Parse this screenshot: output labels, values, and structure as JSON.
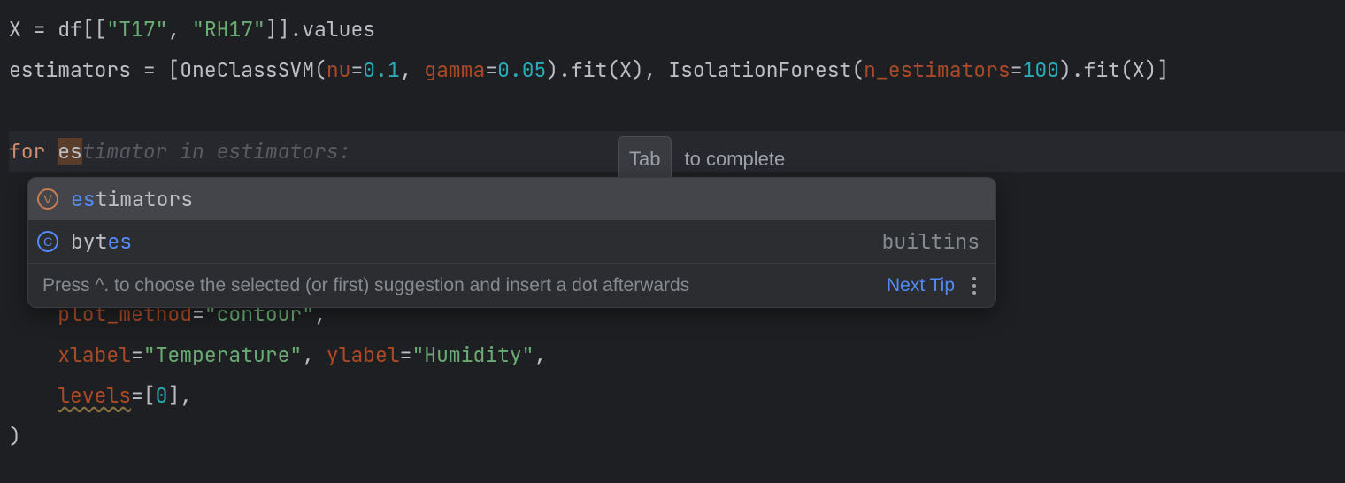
{
  "code": {
    "line1": {
      "a": "X ",
      "eq": "= ",
      "b": "df[[",
      "s1": "\"T17\"",
      "c": ", ",
      "s2": "\"RH17\"",
      "d": "]].values"
    },
    "line2": {
      "a": "estimators ",
      "eq": "= ",
      "b": "[OneClassSVM(",
      "p1": "nu",
      "eq1": "=",
      "n1": "0.1",
      "c1": ", ",
      "p2": "gamma",
      "eq2": "=",
      "n2": "0.05",
      "d": ").fit(X), IsolationForest(",
      "p3": "n_estimators",
      "eq3": "=",
      "n3": "100",
      "e": ").fit(X)]"
    },
    "line3": {
      "kw": "for ",
      "typed": "es",
      "ghost": "timator in estimators:"
    },
    "line5": {
      "pad": "    ",
      "p": "plot_method",
      "eq": "=",
      "s": "\"contour\"",
      "c": ","
    },
    "line6": {
      "pad": "    ",
      "p1": "xlabel",
      "eq1": "=",
      "s1": "\"Temperature\"",
      "c1": ", ",
      "p2": "ylabel",
      "eq2": "=",
      "s2": "\"Humidity\"",
      "c2": ","
    },
    "line7": {
      "pad": "    ",
      "p": "levels",
      "eq": "=[",
      "n": "0",
      "c": "],"
    },
    "line8": {
      "a": ")"
    }
  },
  "hint": {
    "key": "Tab",
    "text": "to complete"
  },
  "popup": {
    "items": [
      {
        "kind": "V",
        "match": "es",
        "rest": "timators",
        "tail": ""
      },
      {
        "kind": "C",
        "match_pre": "byt",
        "match": "es",
        "rest": "",
        "tail": "builtins"
      }
    ],
    "footer": {
      "tip": "Press ^. to choose the selected (or first) suggestion and insert a dot afterwards",
      "next": "Next Tip"
    }
  }
}
